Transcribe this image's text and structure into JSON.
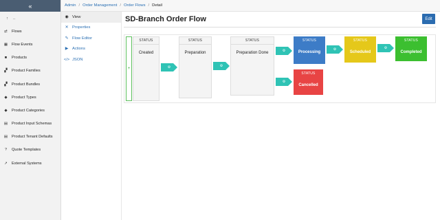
{
  "sidebar": {
    "collapse_icon": "«",
    "items": [
      {
        "label": "..",
        "icon": "arrow-up-icon",
        "glyph": "↑"
      },
      {
        "label": "Flows",
        "icon": "flows-icon",
        "glyph": "⇄"
      },
      {
        "label": "Flow Events",
        "icon": "calendar-icon",
        "glyph": "▦"
      },
      {
        "label": "Products",
        "icon": "box-icon",
        "glyph": "■"
      },
      {
        "label": "Product Families",
        "icon": "cubes-icon",
        "glyph": "▞"
      },
      {
        "label": "Product Bundles",
        "icon": "cubes-icon",
        "glyph": "▞"
      },
      {
        "label": "Product Types",
        "icon": "tag-icon",
        "glyph": "◆"
      },
      {
        "label": "Product Categories",
        "icon": "tags-icon",
        "glyph": "◆"
      },
      {
        "label": "Product Input Schemas",
        "icon": "document-icon",
        "glyph": "▤"
      },
      {
        "label": "Product Tenant Defaults",
        "icon": "document-icon",
        "glyph": "▤"
      },
      {
        "label": "Quote Templates",
        "icon": "question-icon",
        "glyph": "?"
      },
      {
        "label": "External Systems",
        "icon": "external-link-icon",
        "glyph": "↗"
      }
    ]
  },
  "breadcrumb": {
    "items": [
      "Admin",
      "Order Management",
      "Order Flows"
    ],
    "current": "Detail",
    "separator": "/"
  },
  "subnav": {
    "items": [
      {
        "label": "View",
        "glyph": "◉"
      },
      {
        "label": "Properties",
        "glyph": "✕"
      },
      {
        "label": "Flow Editor",
        "glyph": "✎"
      },
      {
        "label": "Actions",
        "glyph": "▶"
      },
      {
        "label": "JSON",
        "glyph": "</>"
      }
    ]
  },
  "page": {
    "title": "SD-Branch Order Flow",
    "edit_label": "Edit"
  },
  "flow": {
    "start_glyph": "+",
    "arrow_glyph": "⚙",
    "arrow_color": "#2fc3b5",
    "nodes": [
      {
        "status": "STATUS",
        "name": "Created",
        "color": ""
      },
      {
        "status": "STATUS",
        "name": "Preparation",
        "color": ""
      },
      {
        "status": "STATUS",
        "name": "Preparation Done",
        "color": ""
      },
      {
        "status": "STATUS",
        "name": "Processing",
        "color": "#3d7cc7"
      },
      {
        "status": "STATUS",
        "name": "Scheduled",
        "color": "#e5c81a"
      },
      {
        "status": "STATUS",
        "name": "Completed",
        "color": "#3cbf30"
      },
      {
        "status": "STATUS",
        "name": "Cancelled",
        "color": "#e84444"
      }
    ]
  }
}
